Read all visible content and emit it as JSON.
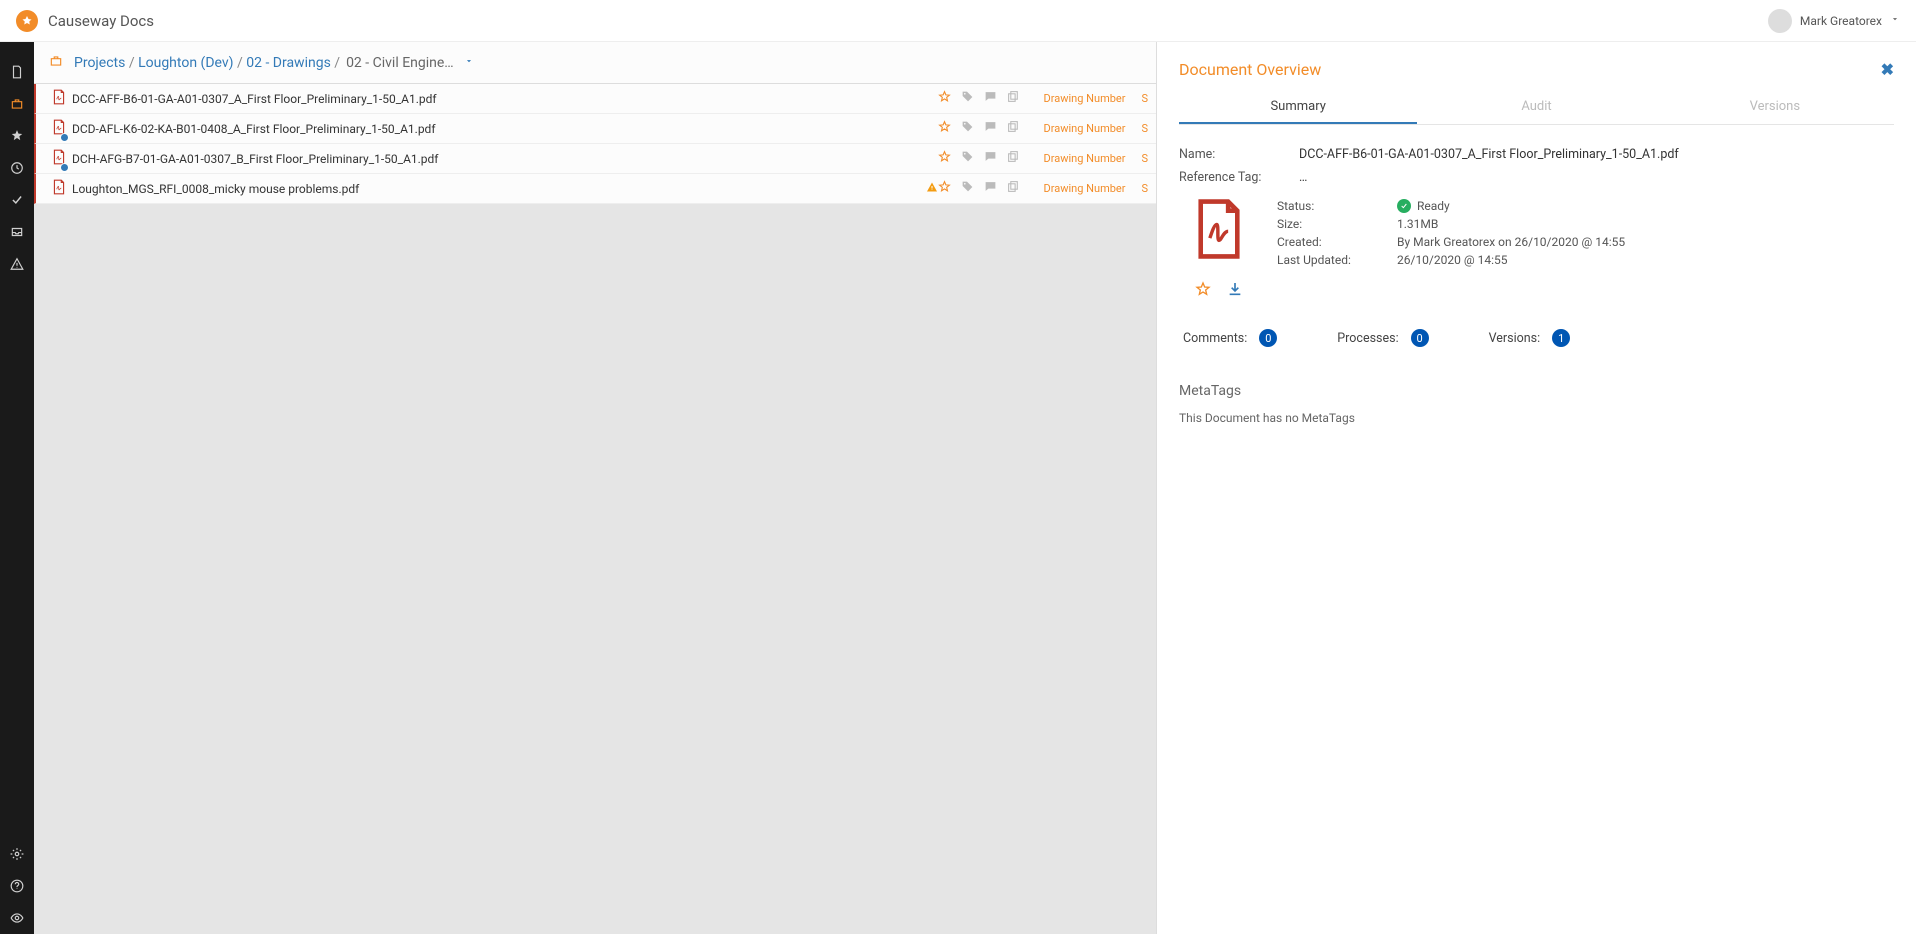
{
  "app": {
    "title": "Causeway Docs",
    "user_name": "Mark Greatorex"
  },
  "breadcrumb": {
    "items": [
      "Projects",
      "Loughton (Dev)",
      "02 - Drawings"
    ],
    "current": "02 - Civil Engine…"
  },
  "files": [
    {
      "name": "DCC-AFF-B6-01-GA-A01-0307_A_First Floor_Preliminary_1-50_A1.pdf",
      "label": "Drawing Number",
      "sync": false,
      "warn": false,
      "trunc": "S"
    },
    {
      "name": "DCD-AFL-K6-02-KA-B01-0408_A_First Floor_Preliminary_1-50_A1.pdf",
      "label": "Drawing Number",
      "sync": true,
      "warn": false,
      "trunc": "S"
    },
    {
      "name": "DCH-AFG-B7-01-GA-A01-0307_B_First Floor_Preliminary_1-50_A1.pdf",
      "label": "Drawing Number",
      "sync": true,
      "warn": false,
      "trunc": "S"
    },
    {
      "name": "Loughton_MGS_RFI_0008_micky mouse problems.pdf",
      "label": "Drawing Number",
      "sync": false,
      "warn": true,
      "trunc": "S"
    }
  ],
  "detail": {
    "title": "Document Overview",
    "tabs": {
      "summary": "Summary",
      "audit": "Audit",
      "versions": "Versions"
    },
    "name_label": "Name:",
    "name_value": "DCC-AFF-B6-01-GA-A01-0307_A_First Floor_Preliminary_1-50_A1.pdf",
    "ref_label": "Reference Tag:",
    "ref_value": "…",
    "status_label": "Status:",
    "status_value": "Ready",
    "size_label": "Size:",
    "size_value": "1.31MB",
    "created_label": "Created:",
    "created_value": "By Mark Greatorex on 26/10/2020 @ 14:55",
    "updated_label": "Last Updated:",
    "updated_value": "26/10/2020 @ 14:55",
    "counts": {
      "comments_label": "Comments:",
      "comments_value": "0",
      "processes_label": "Processes:",
      "processes_value": "0",
      "versions_label": "Versions:",
      "versions_value": "1"
    },
    "metatags_title": "MetaTags",
    "metatags_empty": "This Document has no MetaTags"
  }
}
